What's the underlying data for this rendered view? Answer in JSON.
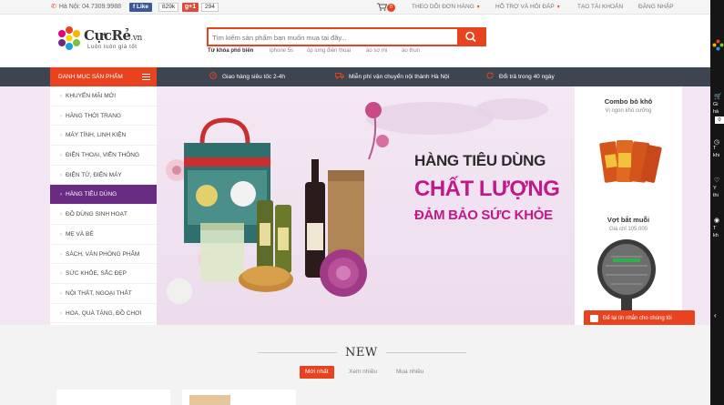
{
  "topbar": {
    "phone": "Hà Nội: 04.7309.9988",
    "fb_like": "Like",
    "fb_count": "829k",
    "gplus": "g+1",
    "gplus_count": "294",
    "cart_count": "0",
    "links": [
      "THEO DÕI ĐƠN HÀNG",
      "HỖ TRỢ VÀ HỎI ĐÁP",
      "TẠO TÀI KHOẢN",
      "ĐĂNG NHẬP"
    ]
  },
  "logo": {
    "brand": "CựcRẻ",
    "brand_suffix": ".vn",
    "slogan": "Luôn luôn giá tốt"
  },
  "search": {
    "placeholder": "Tìm kiếm sản phẩm bạn muốn mua tại đây...",
    "keywords_label": "Từ khóa phổ biến",
    "keywords": [
      "iphone 5s",
      "ốp lưng điện thoại",
      "áo sơ mi",
      "áo thun"
    ]
  },
  "nav": {
    "category_label": "DANH MỤC SẢN PHẨM",
    "features": [
      "Giao hàng siêu tốc 2-4h",
      "Miễn phí vận chuyển nội thành Hà Nội",
      "Đổi trả trong 40 ngày"
    ]
  },
  "menu": [
    "KHUYẾN MÃI MỚI",
    "HÀNG THỜI TRANG",
    "MÁY TÍNH, LINH KIỆN",
    "ĐIỆN THOẠI, VIỄN THÔNG",
    "ĐIỆN TỬ, ĐIỆN MÁY",
    "HÀNG TIÊU DÙNG",
    "ĐỒ DÙNG SINH HOẠT",
    "MẸ VÀ BÉ",
    "SÁCH, VĂN PHÒNG PHẨM",
    "SỨC KHỎE, SẮC ĐẸP",
    "NỘI THẤT, NGOẠI THẤT",
    "HOA, QUÀ TẶNG, ĐỒ CHƠI"
  ],
  "menu_active_index": 5,
  "banner": {
    "line1": "HÀNG TIÊU DÙNG",
    "line2": "CHẤT LƯỢNG",
    "line3": "ĐẢM BẢO SỨC KHỎE"
  },
  "side_products": [
    {
      "name": "Combo bò khô",
      "desc": "Vị ngon khó cưỡng"
    },
    {
      "name": "Vợt bắt muỗi",
      "desc": "Giá chỉ 105.000"
    }
  ],
  "chat": {
    "label": "Để lại tin nhắn cho chúng tôi"
  },
  "right_panel": {
    "items": [
      "Gi",
      "hà",
      "T",
      "khi",
      "Y",
      "thi",
      "T",
      "kh"
    ],
    "badge": "0"
  },
  "new_section": {
    "title": "NEW",
    "tabs": [
      "Mới nhất",
      "Xem nhiều",
      "Mua nhiều"
    ]
  },
  "colors": {
    "accent": "#e8421f",
    "nav_dark": "#3d4650",
    "active_purple": "#6a2b83",
    "banner_magenta": "#c2188a"
  }
}
